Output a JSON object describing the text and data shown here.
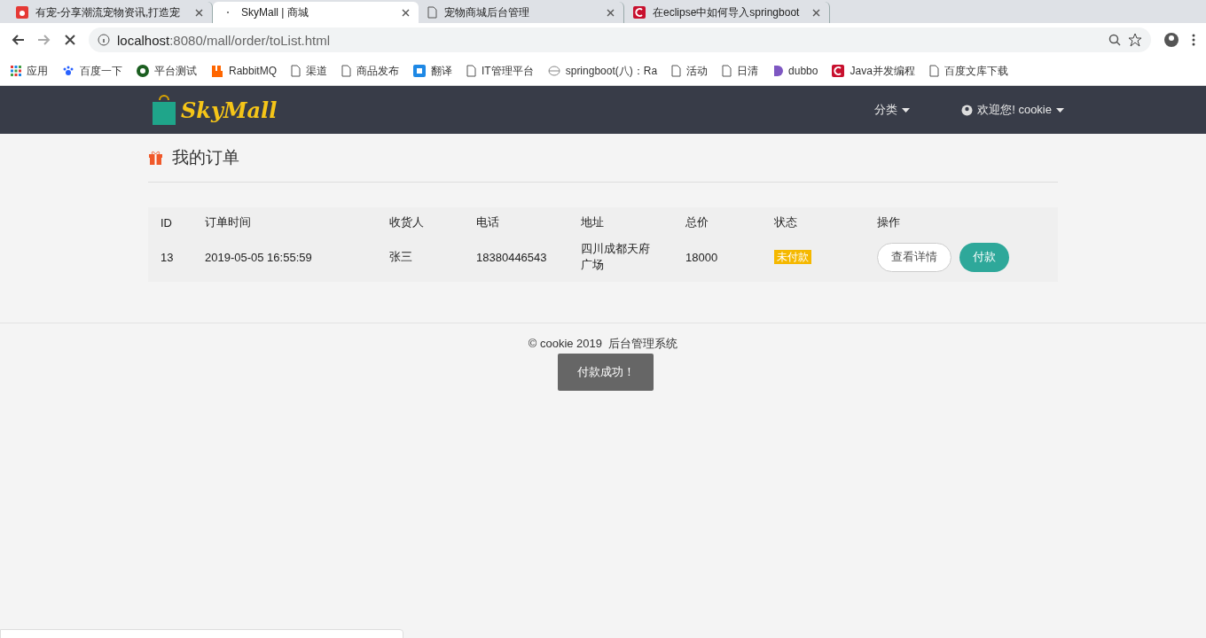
{
  "browser": {
    "tabs": [
      {
        "title": "有宠-分享潮流宠物资讯,打造宠",
        "selected": false,
        "kind": "pet"
      },
      {
        "title": "SkyMall | 商城",
        "selected": true,
        "kind": "loading"
      },
      {
        "title": "宠物商城后台管理",
        "selected": false,
        "kind": "page"
      },
      {
        "title": "在eclipse中如何导入springboot",
        "selected": false,
        "kind": "red"
      }
    ],
    "url_host": "localhost",
    "url_path": ":8080/mall/order/toList.html",
    "bookmarks": [
      {
        "label": "应用",
        "kind": "apps"
      },
      {
        "label": "百度一下",
        "kind": "paw"
      },
      {
        "label": "平台测试",
        "kind": "green"
      },
      {
        "label": "RabbitMQ",
        "kind": "orange"
      },
      {
        "label": "渠道",
        "kind": "page"
      },
      {
        "label": "商品发布",
        "kind": "page"
      },
      {
        "label": "翻译",
        "kind": "blue"
      },
      {
        "label": "IT管理平台",
        "kind": "page"
      },
      {
        "label": "springboot(八)：Ra",
        "kind": "globe"
      },
      {
        "label": "活动",
        "kind": "page"
      },
      {
        "label": "日清",
        "kind": "page"
      },
      {
        "label": "dubbo",
        "kind": "purple"
      },
      {
        "label": "Java并发编程",
        "kind": "red"
      },
      {
        "label": "百度文库下载",
        "kind": "page"
      }
    ]
  },
  "navbar": {
    "logo": "SkyMall",
    "menu": [
      {
        "label": "分类",
        "kind": "plain"
      },
      {
        "label": "欢迎您! cookie",
        "kind": "user"
      }
    ]
  },
  "page_title": "我的订单",
  "table": {
    "columns": [
      "ID",
      "订单时间",
      "收货人",
      "电话",
      "地址",
      "总价",
      "状态",
      "操作"
    ],
    "rows": [
      {
        "id": "13",
        "time": "2019-05-05 16:55:59",
        "receiver": "张三",
        "phone": "18380446543",
        "address": "四川成都天府广场",
        "total": "18000",
        "status": "未付款",
        "actions": [
          {
            "label": "查看详情",
            "kind": "outline"
          },
          {
            "label": "付款",
            "kind": "primary"
          }
        ]
      }
    ]
  },
  "footer": "© cookie 2019  后台管理系统",
  "toast": "付款成功！"
}
